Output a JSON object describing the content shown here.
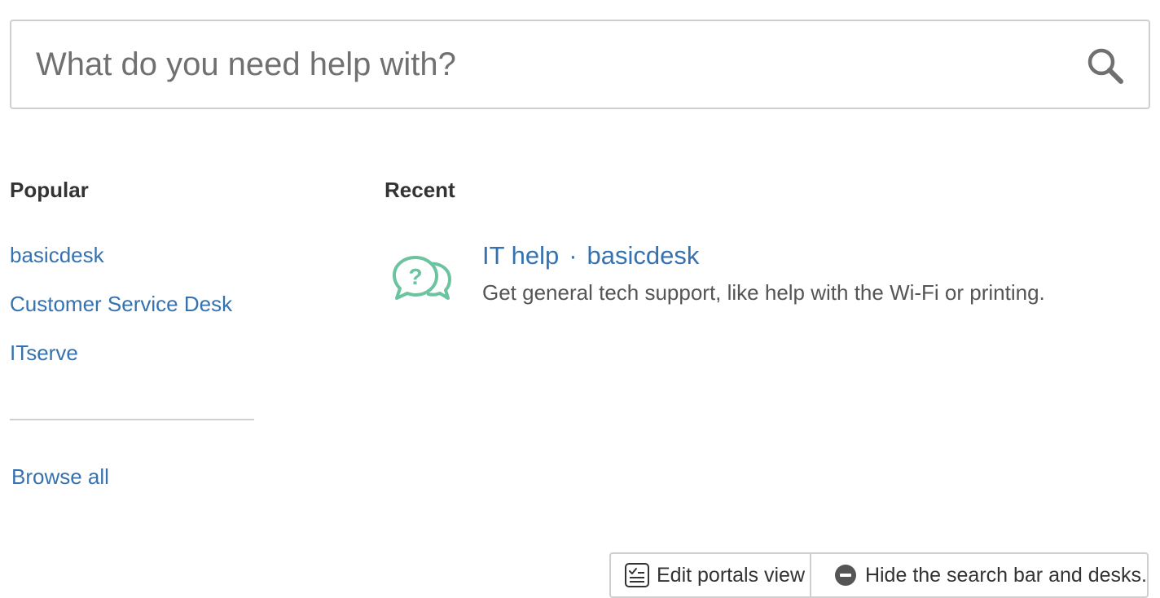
{
  "search": {
    "placeholder": "What do you need help with?"
  },
  "popular": {
    "heading": "Popular",
    "links": [
      {
        "label": "basicdesk"
      },
      {
        "label": "Customer Service Desk"
      },
      {
        "label": "ITserve"
      }
    ],
    "browse_all": "Browse all"
  },
  "recent": {
    "heading": "Recent",
    "items": [
      {
        "name": "IT help",
        "separator": "·",
        "desk": "basicdesk",
        "description": "Get general tech support, like help with the Wi-Fi or printing.",
        "icon": "question-chat-icon"
      }
    ]
  },
  "toolbar": {
    "edit_label": "Edit portals view",
    "hide_label": "Hide the search bar and desks."
  },
  "colors": {
    "link": "#3572b0",
    "icon_green": "#6cc3a0",
    "border": "#cfcfcf"
  }
}
